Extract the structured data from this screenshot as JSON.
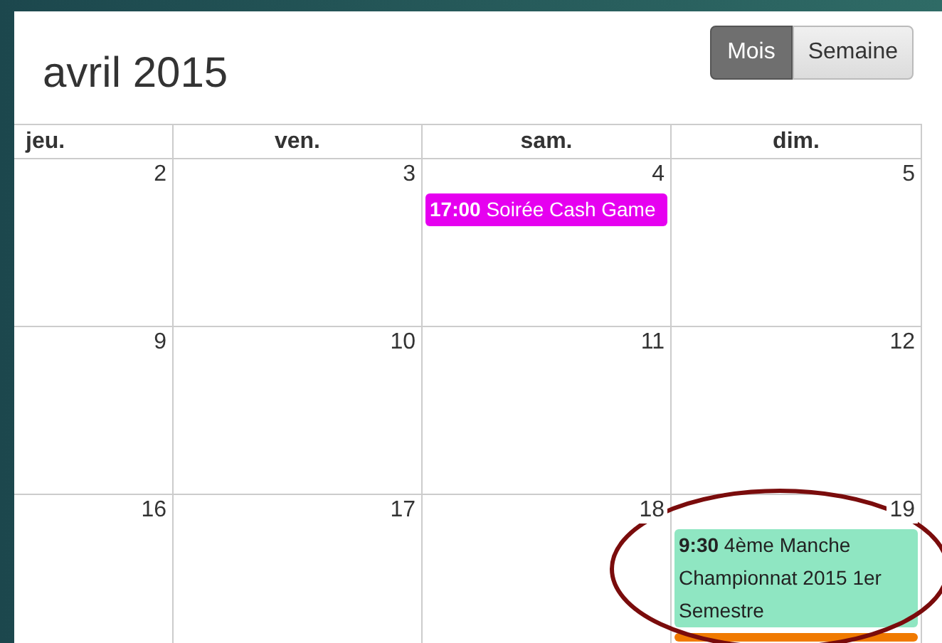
{
  "title": "avril 2015",
  "view_buttons": [
    {
      "label": "Mois",
      "selected": true
    },
    {
      "label": "Semaine",
      "selected": false
    }
  ],
  "weekdays": [
    "jeu.",
    "ven.",
    "sam.",
    "dim."
  ],
  "weeks": [
    {
      "days": [
        {
          "number": "2"
        },
        {
          "number": "3"
        },
        {
          "number": "4",
          "events": [
            {
              "time": "17:00",
              "title": "Soirée Cash Game",
              "color": "#e600f0"
            }
          ]
        },
        {
          "number": "5"
        }
      ]
    },
    {
      "days": [
        {
          "number": "9"
        },
        {
          "number": "10"
        },
        {
          "number": "11"
        },
        {
          "number": "12"
        }
      ]
    },
    {
      "days": [
        {
          "number": "16"
        },
        {
          "number": "17"
        },
        {
          "number": "18"
        },
        {
          "number": "19",
          "events": [
            {
              "time": "9:30",
              "title": "4ème Manche Championnat 2015 1er Semestre",
              "color": "#8fe6c2"
            },
            {
              "color": "#f07a00"
            }
          ]
        }
      ]
    }
  ],
  "annotation": {
    "kind": "ellipse",
    "color": "#7a0c0c"
  }
}
